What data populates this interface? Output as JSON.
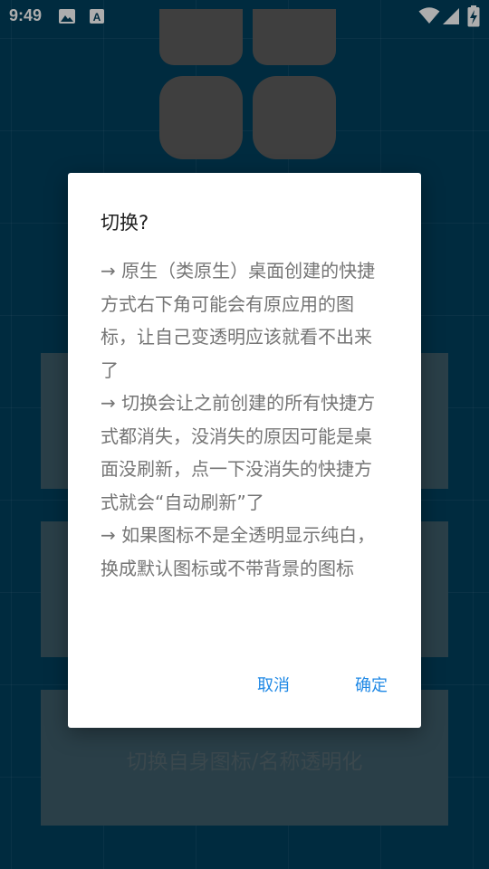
{
  "status_bar": {
    "time": "9:49",
    "icons": [
      "image-icon",
      "text-a-icon",
      "wifi-icon",
      "signal-icon",
      "battery-charging-icon"
    ]
  },
  "background_panels": [
    {
      "label": ""
    },
    {
      "label": ""
    },
    {
      "label": "切换自身图标/名称透明化"
    }
  ],
  "dialog": {
    "title": "切换?",
    "messages": [
      "→ 原生（类原生）桌面创建的快捷方式右下角可能会有原应用的图标，让自己变透明应该就看不出来了",
      "→ 切换会让之前创建的所有快捷方式都消失，没消失的原因可能是桌面没刷新，点一下没消失的快捷方式就会“自动刷新”了",
      "→ 如果图标不是全透明显示纯白，换成默认图标或不带背景的图标"
    ],
    "cancel_label": "取消",
    "confirm_label": "确定"
  },
  "colors": {
    "background": "#00405d",
    "tile": "#5d5d5d",
    "accent": "#1e88e5",
    "dialog_text": "#757575"
  }
}
